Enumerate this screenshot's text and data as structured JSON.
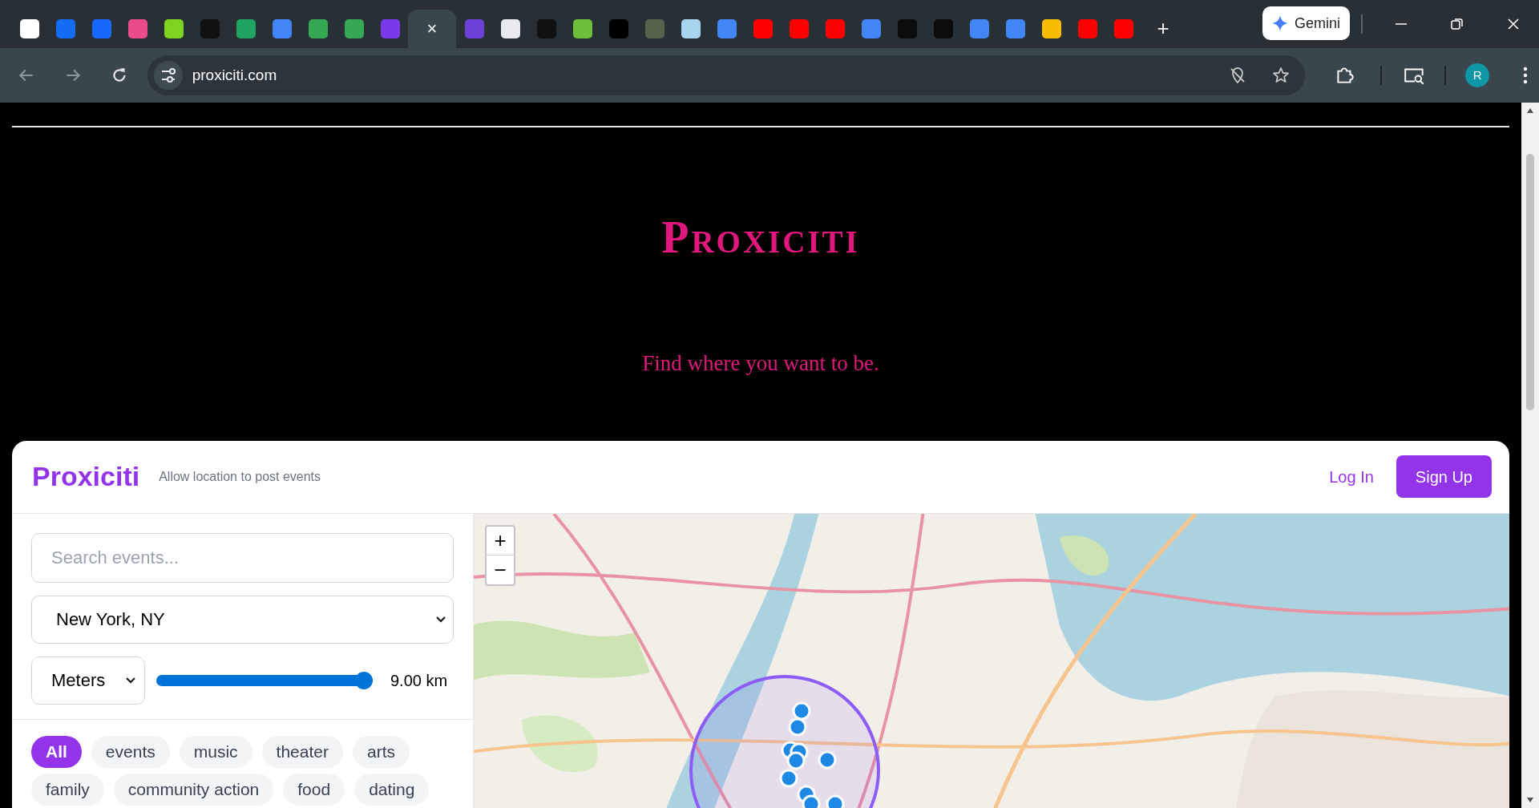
{
  "browser": {
    "tabs": [
      {
        "selected": false
      },
      {
        "selected": false
      },
      {
        "selected": false
      },
      {
        "selected": false
      },
      {
        "selected": false
      },
      {
        "selected": false
      },
      {
        "selected": false
      },
      {
        "selected": false
      },
      {
        "selected": false
      },
      {
        "selected": false
      },
      {
        "selected": false
      },
      {
        "selected": true,
        "close": "×"
      },
      {
        "selected": false
      },
      {
        "selected": false
      },
      {
        "selected": false
      },
      {
        "selected": false
      },
      {
        "selected": false
      },
      {
        "selected": false
      },
      {
        "selected": false
      },
      {
        "selected": false
      },
      {
        "selected": false
      },
      {
        "selected": false
      },
      {
        "selected": false
      },
      {
        "selected": false
      },
      {
        "selected": false
      },
      {
        "selected": false
      },
      {
        "selected": false
      },
      {
        "selected": false
      },
      {
        "selected": false
      },
      {
        "selected": false
      },
      {
        "selected": false
      }
    ],
    "new_tab": "+",
    "gemini": "Gemini",
    "url": "proxiciti.com",
    "profile": "R"
  },
  "hero": {
    "title": "Proxiciti",
    "tagline": "Find where you want to be."
  },
  "app": {
    "brand": "Proxiciti",
    "notice": "Allow location to post events",
    "login": "Log In",
    "signup": "Sign Up",
    "search": {
      "placeholder": "Search events..."
    },
    "city": "New York, NY",
    "unit": "Meters",
    "radius": {
      "level": 0.96,
      "reading": "9.00 km"
    },
    "categories": [
      {
        "label": "All",
        "selected": true
      },
      {
        "label": "events",
        "selected": false
      },
      {
        "label": "music",
        "selected": false
      },
      {
        "label": "theater",
        "selected": false
      },
      {
        "label": "arts",
        "selected": false
      },
      {
        "label": "family",
        "selected": false
      },
      {
        "label": "community action",
        "selected": false
      },
      {
        "label": "food",
        "selected": false
      },
      {
        "label": "dating",
        "selected": false
      }
    ],
    "map": {
      "kind": "picture",
      "zoom_in": "+",
      "zoom_out": "−"
    }
  }
}
